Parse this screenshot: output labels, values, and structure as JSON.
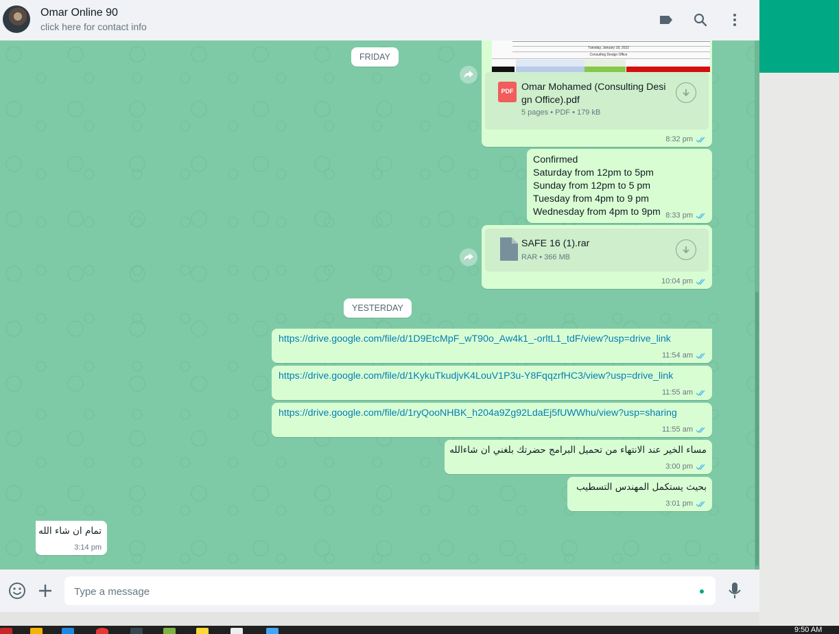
{
  "header": {
    "contact_name": "Omar Online 90",
    "contact_subtitle": "click here for contact info",
    "icons": [
      "label-icon",
      "search-icon",
      "menu-icon"
    ]
  },
  "dates": {
    "friday": "FRIDAY",
    "yesterday": "YESTERDAY"
  },
  "messages": {
    "pdf": {
      "file_name_line1": "Omar Mohamed (Consulting Desi",
      "file_name_line2": "gn Office).pdf",
      "file_badge": "PDF",
      "details": "5 pages • PDF • 179 kB",
      "time": "8:32 pm",
      "preview_title": "Consulting Design Office",
      "preview_date": "Tuesday, January 18, 2022"
    },
    "confirmed": {
      "lines": [
        "Confirmed",
        "Saturday from 12pm to 5pm",
        "Sunday from 12pm to 5 pm",
        "Tuesday from 4pm to 9 pm",
        "Wednesday from 4pm to 9pm"
      ],
      "time": "8:33 pm"
    },
    "rar": {
      "file_name": "SAFE 16 (1).rar",
      "details": "RAR • 366 MB",
      "time": "10:04 pm"
    },
    "link1": {
      "text": "https://drive.google.com/file/d/1D9EtcMpF_wT90o_Aw4k1_-orltL1_tdF/view?usp=drive_link",
      "time": "11:54 am"
    },
    "link2": {
      "text": "https://drive.google.com/file/d/1KykuTkudjvK4LouV1P3u-Y8FqqzrfHC3/view?usp=drive_link",
      "time": "11:55 am"
    },
    "link3": {
      "text": "https://drive.google.com/file/d/1ryQooNHBK_h204a9Zg92LdaEj5fUWWhu/view?usp=sharing",
      "time": "11:55 am"
    },
    "arabic1": {
      "text": "مساء الخير عند الانتهاء من تحميل البرامج حضرتك بلغني ان شاءالله",
      "time": "3:00 pm"
    },
    "arabic2": {
      "text": "بحيث يستكمل المهندس التسطيب",
      "time": "3:01 pm"
    },
    "incoming": {
      "text": "تمام ان شاء الله",
      "time": "3:14 pm"
    }
  },
  "composer": {
    "placeholder": "Type a message",
    "icons": [
      "emoji-icon",
      "plus-icon",
      "mic-icon"
    ]
  },
  "taskbar": {
    "clock": "9:50 AM"
  },
  "colors": {
    "chat_bg": "#7fcaa6",
    "outgoing": "#d9fdd3",
    "accent": "#00a884",
    "link": "#027eb5",
    "tick": "#53bdeb"
  }
}
